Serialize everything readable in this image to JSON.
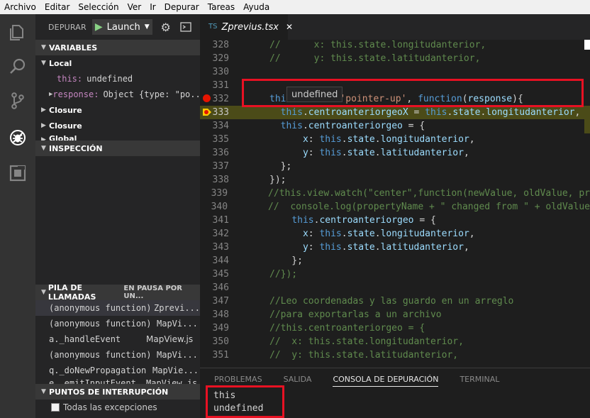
{
  "menu": [
    "Archivo",
    "Editar",
    "Selección",
    "Ver",
    "Ir",
    "Depurar",
    "Tareas",
    "Ayuda"
  ],
  "activity_bar": [
    "files-icon",
    "search-icon",
    "source-control-icon",
    "debug-icon",
    "extensions-icon"
  ],
  "debug_toolbar": {
    "label": "DEPURAR",
    "config": "Launch"
  },
  "variables": {
    "title": "VARIABLES",
    "local_label": "Local",
    "this_name": "this:",
    "this_value": "undefined",
    "response_name": "response:",
    "response_value": "Object {type: \"po...",
    "closure1": "Closure",
    "closure2": "Closure",
    "global": "Global"
  },
  "watch": {
    "title": "INSPECCIÓN"
  },
  "callstack": {
    "title": "PILA DE LLAMADAS",
    "status": "EN PAUSA POR UN...",
    "frames": [
      {
        "fn": "(anonymous function)",
        "file": "Zprevi..."
      },
      {
        "fn": "(anonymous function)",
        "file": "MapVi..."
      },
      {
        "fn": "a._handleEvent",
        "file": "MapView.js"
      },
      {
        "fn": "(anonymous function)",
        "file": "MapVi..."
      },
      {
        "fn": "q._doNewPropagation",
        "file": "MapVie..."
      },
      {
        "fn": "e._emitInputEvent",
        "file": "MapView.js"
      }
    ]
  },
  "breakpoints": {
    "title": "PUNTOS DE INTERRUPCIÓN",
    "all_exceptions": "Todas las excepciones"
  },
  "editor": {
    "tab_icon": "TS",
    "tab_title": "Zprevius.tsx",
    "hover_tooltip": "undefined",
    "line_numbers": [
      "328",
      "329",
      "330",
      "331",
      "332",
      "333",
      "334",
      "335",
      "336",
      "337",
      "338",
      "339",
      "340",
      "341",
      "342",
      "343",
      "344",
      "345",
      "346",
      "347",
      "348",
      "349",
      "350",
      "351"
    ]
  },
  "panel": {
    "tabs": [
      "PROBLEMAS",
      "SALIDA",
      "CONSOLA DE DEPURACIÓN",
      "TERMINAL"
    ],
    "output": [
      "this",
      "undefined"
    ]
  },
  "colors": {
    "accent_red": "#e81123",
    "current_line": "#4b4b18",
    "breakpoint": "#e51400",
    "stack_arrow": "#ffcc00"
  }
}
